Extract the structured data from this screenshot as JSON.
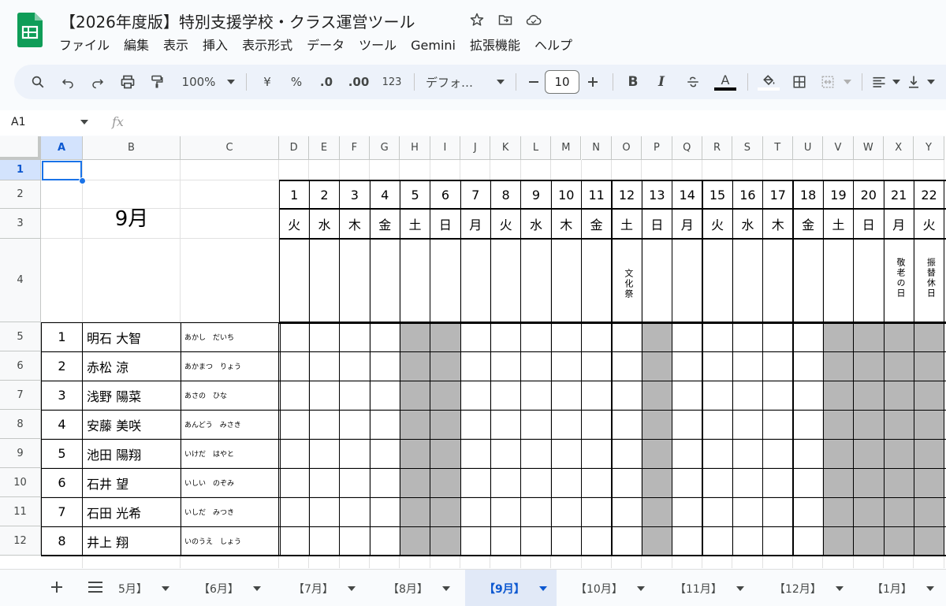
{
  "app": {
    "title": "【2026年度版】特別支援学校・クラス運営ツール"
  },
  "menu": [
    "ファイル",
    "編集",
    "表示",
    "挿入",
    "表示形式",
    "データ",
    "ツール",
    "Gemini",
    "拡張機能",
    "ヘルプ"
  ],
  "toolbar": {
    "zoom": "100%",
    "currency": "¥",
    "percent": "%",
    "dec_less": ".0",
    "dec_more": ".00",
    "number_format": "123",
    "font": "デフォ…",
    "font_size": "10",
    "bold": "B",
    "italic": "I",
    "text_color": "A"
  },
  "formula_bar": {
    "cell_ref": "A1",
    "fx": "fx"
  },
  "columns": [
    "A",
    "B",
    "C",
    "D",
    "E",
    "F",
    "G",
    "H",
    "I",
    "J",
    "K",
    "L",
    "M",
    "N",
    "O",
    "P",
    "Q",
    "R",
    "S",
    "T",
    "U",
    "V",
    "W",
    "X",
    "Y"
  ],
  "rows": [
    "1",
    "2",
    "3",
    "4",
    "5",
    "6",
    "7",
    "8",
    "9",
    "10",
    "11",
    "12"
  ],
  "sheet": {
    "month_label": "9月",
    "days": [
      "1",
      "2",
      "3",
      "4",
      "5",
      "6",
      "7",
      "8",
      "9",
      "10",
      "11",
      "12",
      "13",
      "14",
      "15",
      "16",
      "17",
      "18",
      "19",
      "20",
      "21",
      "22"
    ],
    "weekdays": [
      "火",
      "水",
      "木",
      "金",
      "土",
      "日",
      "月",
      "火",
      "水",
      "木",
      "金",
      "土",
      "日",
      "月",
      "火",
      "水",
      "木",
      "金",
      "土",
      "日",
      "月",
      "火"
    ],
    "events": {
      "o": "文化祭",
      "x": "敬老の日",
      "y": "振替休日"
    },
    "students": [
      {
        "no": "1",
        "name": "明石 大智",
        "kana": "あかし　だいち"
      },
      {
        "no": "2",
        "name": "赤松 涼",
        "kana": "あかまつ　りょう"
      },
      {
        "no": "3",
        "name": "浅野 陽菜",
        "kana": "あさの　ひな"
      },
      {
        "no": "4",
        "name": "安藤 美咲",
        "kana": "あんどう　みさき"
      },
      {
        "no": "5",
        "name": "池田 陽翔",
        "kana": "いけだ　はやと"
      },
      {
        "no": "6",
        "name": "石井 望",
        "kana": "いしい　のぞみ"
      },
      {
        "no": "7",
        "name": "石田 光希",
        "kana": "いしだ　みつき"
      },
      {
        "no": "8",
        "name": "井上 翔",
        "kana": "いのうえ　しょう"
      }
    ]
  },
  "tabs": [
    "5月】",
    "【6月】",
    "【7月】",
    "【8月】",
    "【9月】",
    "【10月】",
    "【11月】",
    "【12月】",
    "【1月】"
  ],
  "active_tab": "【9月】",
  "colors": {
    "accent": "#0b57d0",
    "selection": "#1a73e8",
    "shade": "#b7b7b7",
    "sheets_green": "#0f9d58"
  }
}
